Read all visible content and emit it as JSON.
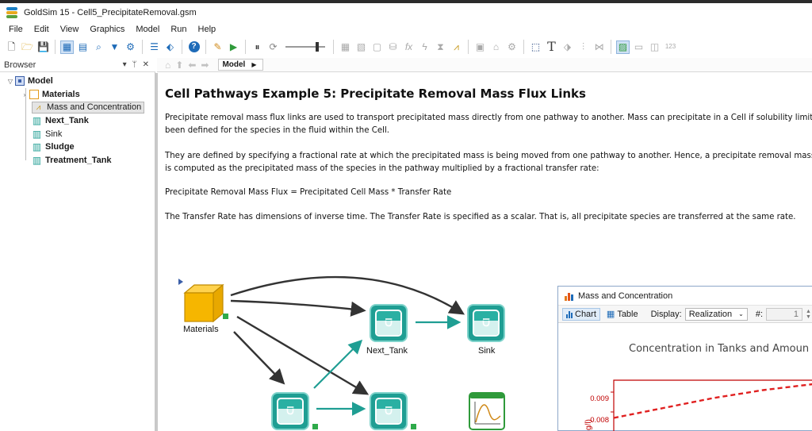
{
  "window": {
    "title": "GoldSim 15  -  Cell5_PrecipitateRemoval.gsm"
  },
  "menu": [
    "File",
    "Edit",
    "View",
    "Graphics",
    "Model",
    "Run",
    "Help"
  ],
  "browser": {
    "header": "Browser",
    "ctrls": [
      "▾",
      "ᛘ",
      "✕"
    ],
    "tree": [
      {
        "label": "Model",
        "bold": true
      },
      {
        "label": "Materials",
        "bold": true
      },
      {
        "label": "Mass and Concentration",
        "bold": false
      },
      {
        "label": "Next_Tank",
        "bold": true
      },
      {
        "label": "Sink",
        "bold": false
      },
      {
        "label": "Sludge",
        "bold": true
      },
      {
        "label": "Treatment_Tank",
        "bold": true
      }
    ]
  },
  "nav": {
    "breadcrumb": "Model"
  },
  "document": {
    "title": "Cell Pathways Example 5: Precipitate Removal Mass Flux Links",
    "p1_line1": "Precipitate removal mass flux links are used to transport precipitated mass directly from one pathway to another. Mass can precipitate in a Cell if solubility limits",
    "p1_line2": "been defined for the species in the fluid within the Cell.",
    "p2_line1": "They are defined by specifying a fractional rate at which the precipitated mass is being moved from one pathway to another.  Hence, a precipitate removal mass",
    "p2_line2": "is computed as the precipitated mass of the species in the pathway multiplied by a fractional transfer rate:",
    "formula": "Precipitate Removal Mass Flux = Precipitated Cell Mass * Transfer Rate",
    "p3": "The Transfer Rate has dimensions of inverse time. The Transfer Rate is specified as a scalar.  That is, all precipitate species are transferred at the same rate."
  },
  "diagram": {
    "materials": "Materials",
    "next_tank": "Next_Tank",
    "sink": "Sink"
  },
  "chart_window": {
    "title": "Mass and Concentration",
    "tab_chart": "Chart",
    "tab_table": "Table",
    "display_label": "Display:",
    "display_value": "Realization",
    "num_label": "#:",
    "num_value": "1",
    "chart_title": "Concentration in Tanks and Amoun",
    "y_axis_label": "g/l)",
    "y_ticks": [
      "0.009",
      "0.008"
    ],
    "series_color": "#e02020"
  },
  "chart_data": {
    "type": "line",
    "title": "Concentration in Tanks and Amoun",
    "ylabel": "g/l)",
    "y_ticks": [
      0.009,
      0.008
    ],
    "series": [
      {
        "color": "#e02020",
        "style": "dashed",
        "x": [
          0.0,
          0.25,
          0.5,
          0.75,
          1.0
        ],
        "values": [
          0.0077,
          0.0082,
          0.0087,
          0.0091,
          0.0094
        ]
      }
    ]
  }
}
